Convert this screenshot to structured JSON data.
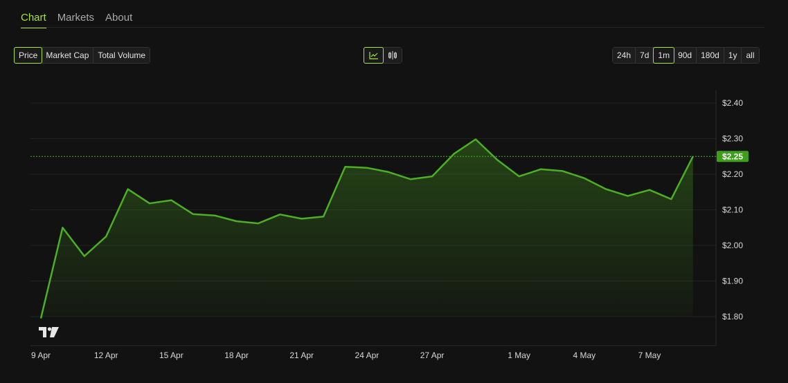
{
  "tabs": [
    {
      "label": "Chart",
      "active": true
    },
    {
      "label": "Markets",
      "active": false
    },
    {
      "label": "About",
      "active": false
    }
  ],
  "metrics": [
    {
      "label": "Price",
      "active": true
    },
    {
      "label": "Market Cap",
      "active": false
    },
    {
      "label": "Total Volume",
      "active": false
    }
  ],
  "views": [
    {
      "icon": "line-chart-icon",
      "active": true
    },
    {
      "icon": "candlestick-chart-icon",
      "active": false
    }
  ],
  "ranges": [
    {
      "label": "24h",
      "active": false
    },
    {
      "label": "7d",
      "active": false
    },
    {
      "label": "1m",
      "active": true
    },
    {
      "label": "90d",
      "active": false
    },
    {
      "label": "180d",
      "active": false
    },
    {
      "label": "1y",
      "active": false
    },
    {
      "label": "all",
      "active": false
    }
  ],
  "colors": {
    "accent": "#a3e635",
    "line": "#4caf24",
    "price_tag": "#3f9e1c"
  },
  "chart_data": {
    "type": "area",
    "y_ticks": [
      "$2.40",
      "$2.30",
      "$2.20",
      "$2.10",
      "$2.00",
      "$1.90",
      "$1.80"
    ],
    "y_tick_values": [
      2.4,
      2.3,
      2.2,
      2.1,
      2.0,
      1.9,
      1.8
    ],
    "ylim": [
      1.8,
      2.4
    ],
    "x_ticks": [
      {
        "label": "9 Apr",
        "day": 0
      },
      {
        "label": "12 Apr",
        "day": 3
      },
      {
        "label": "15 Apr",
        "day": 6
      },
      {
        "label": "18 Apr",
        "day": 9
      },
      {
        "label": "21 Apr",
        "day": 12
      },
      {
        "label": "24 Apr",
        "day": 15
      },
      {
        "label": "27 Apr",
        "day": 18
      },
      {
        "label": "1 May",
        "day": 22
      },
      {
        "label": "4 May",
        "day": 25
      },
      {
        "label": "7 May",
        "day": 28
      }
    ],
    "xlim": [
      0,
      30.5
    ],
    "series": [
      {
        "x": [
          0,
          1,
          2,
          3,
          4,
          5,
          6,
          7,
          8,
          9,
          10,
          11,
          12,
          13,
          14,
          15,
          16,
          17,
          18,
          19,
          20,
          21,
          22,
          23,
          24,
          25,
          26,
          27,
          28,
          29,
          30
        ],
        "values": [
          1.795,
          2.05,
          1.97,
          2.025,
          2.158,
          2.118,
          2.127,
          2.088,
          2.084,
          2.068,
          2.062,
          2.087,
          2.075,
          2.081,
          2.221,
          2.218,
          2.206,
          2.186,
          2.194,
          2.257,
          2.298,
          2.24,
          2.194,
          2.214,
          2.209,
          2.189,
          2.158,
          2.139,
          2.156,
          2.13,
          2.25
        ]
      }
    ],
    "last_price_label": "$2.25",
    "last_price": 2.25,
    "grid": true,
    "watermark": "TV"
  }
}
